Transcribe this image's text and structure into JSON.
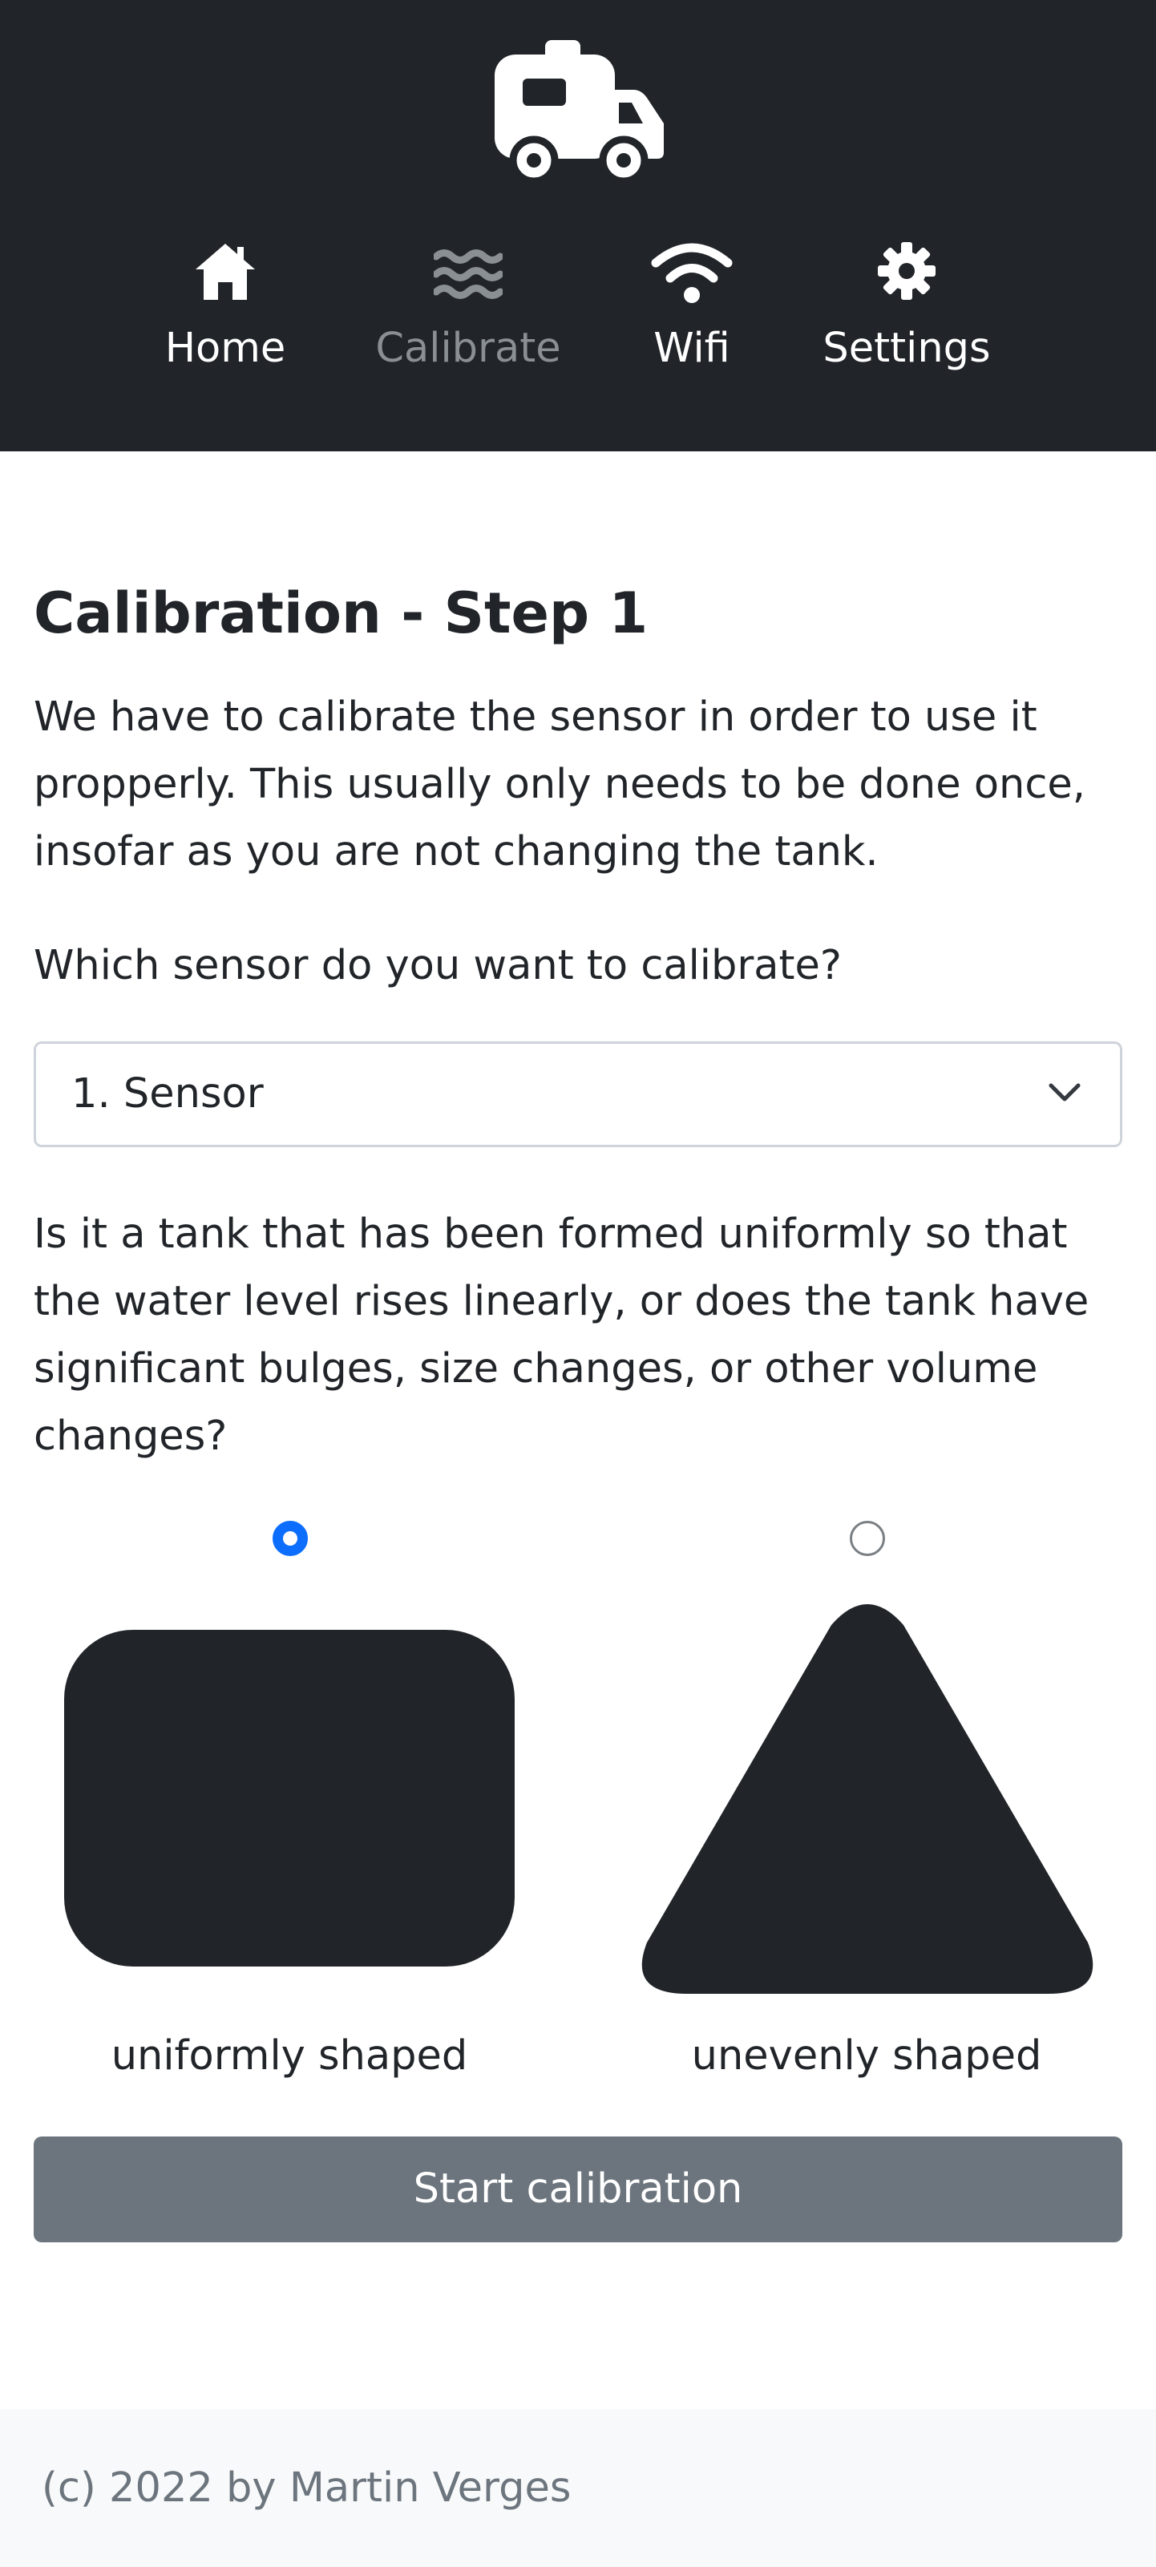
{
  "header": {
    "logo_icon": "caravan-icon",
    "nav": [
      {
        "label": "Home",
        "icon": "home-icon",
        "active": true
      },
      {
        "label": "Calibrate",
        "icon": "water-waves-icon",
        "active": false
      },
      {
        "label": "Wifi",
        "icon": "wifi-icon",
        "active": true
      },
      {
        "label": "Settings",
        "icon": "gear-icon",
        "active": true
      }
    ]
  },
  "main": {
    "title": "Calibration - Step 1",
    "intro": "We have to calibrate the sensor in order to use it propperly. This usually only needs to be done once, insofar as you are not changing the tank.",
    "sensor_question": "Which sensor do you want to calibrate?",
    "sensor_select": {
      "value": "1. Sensor"
    },
    "shape_question": "Is it a tank that has been formed uniformly so that the water level rises linearly, or does the tank have significant bulges, size changes, or other volume changes?",
    "shape_options": [
      {
        "label": "uniformly shaped",
        "selected": true
      },
      {
        "label": "unevenly shaped",
        "selected": false
      }
    ],
    "start_button": "Start calibration"
  },
  "footer": {
    "text": "(c) 2022 by Martin Verges"
  },
  "colors": {
    "header_bg": "#212529",
    "accent": "#0d6efd",
    "button_bg": "#6c757d",
    "footer_bg": "#f8f9fa"
  }
}
